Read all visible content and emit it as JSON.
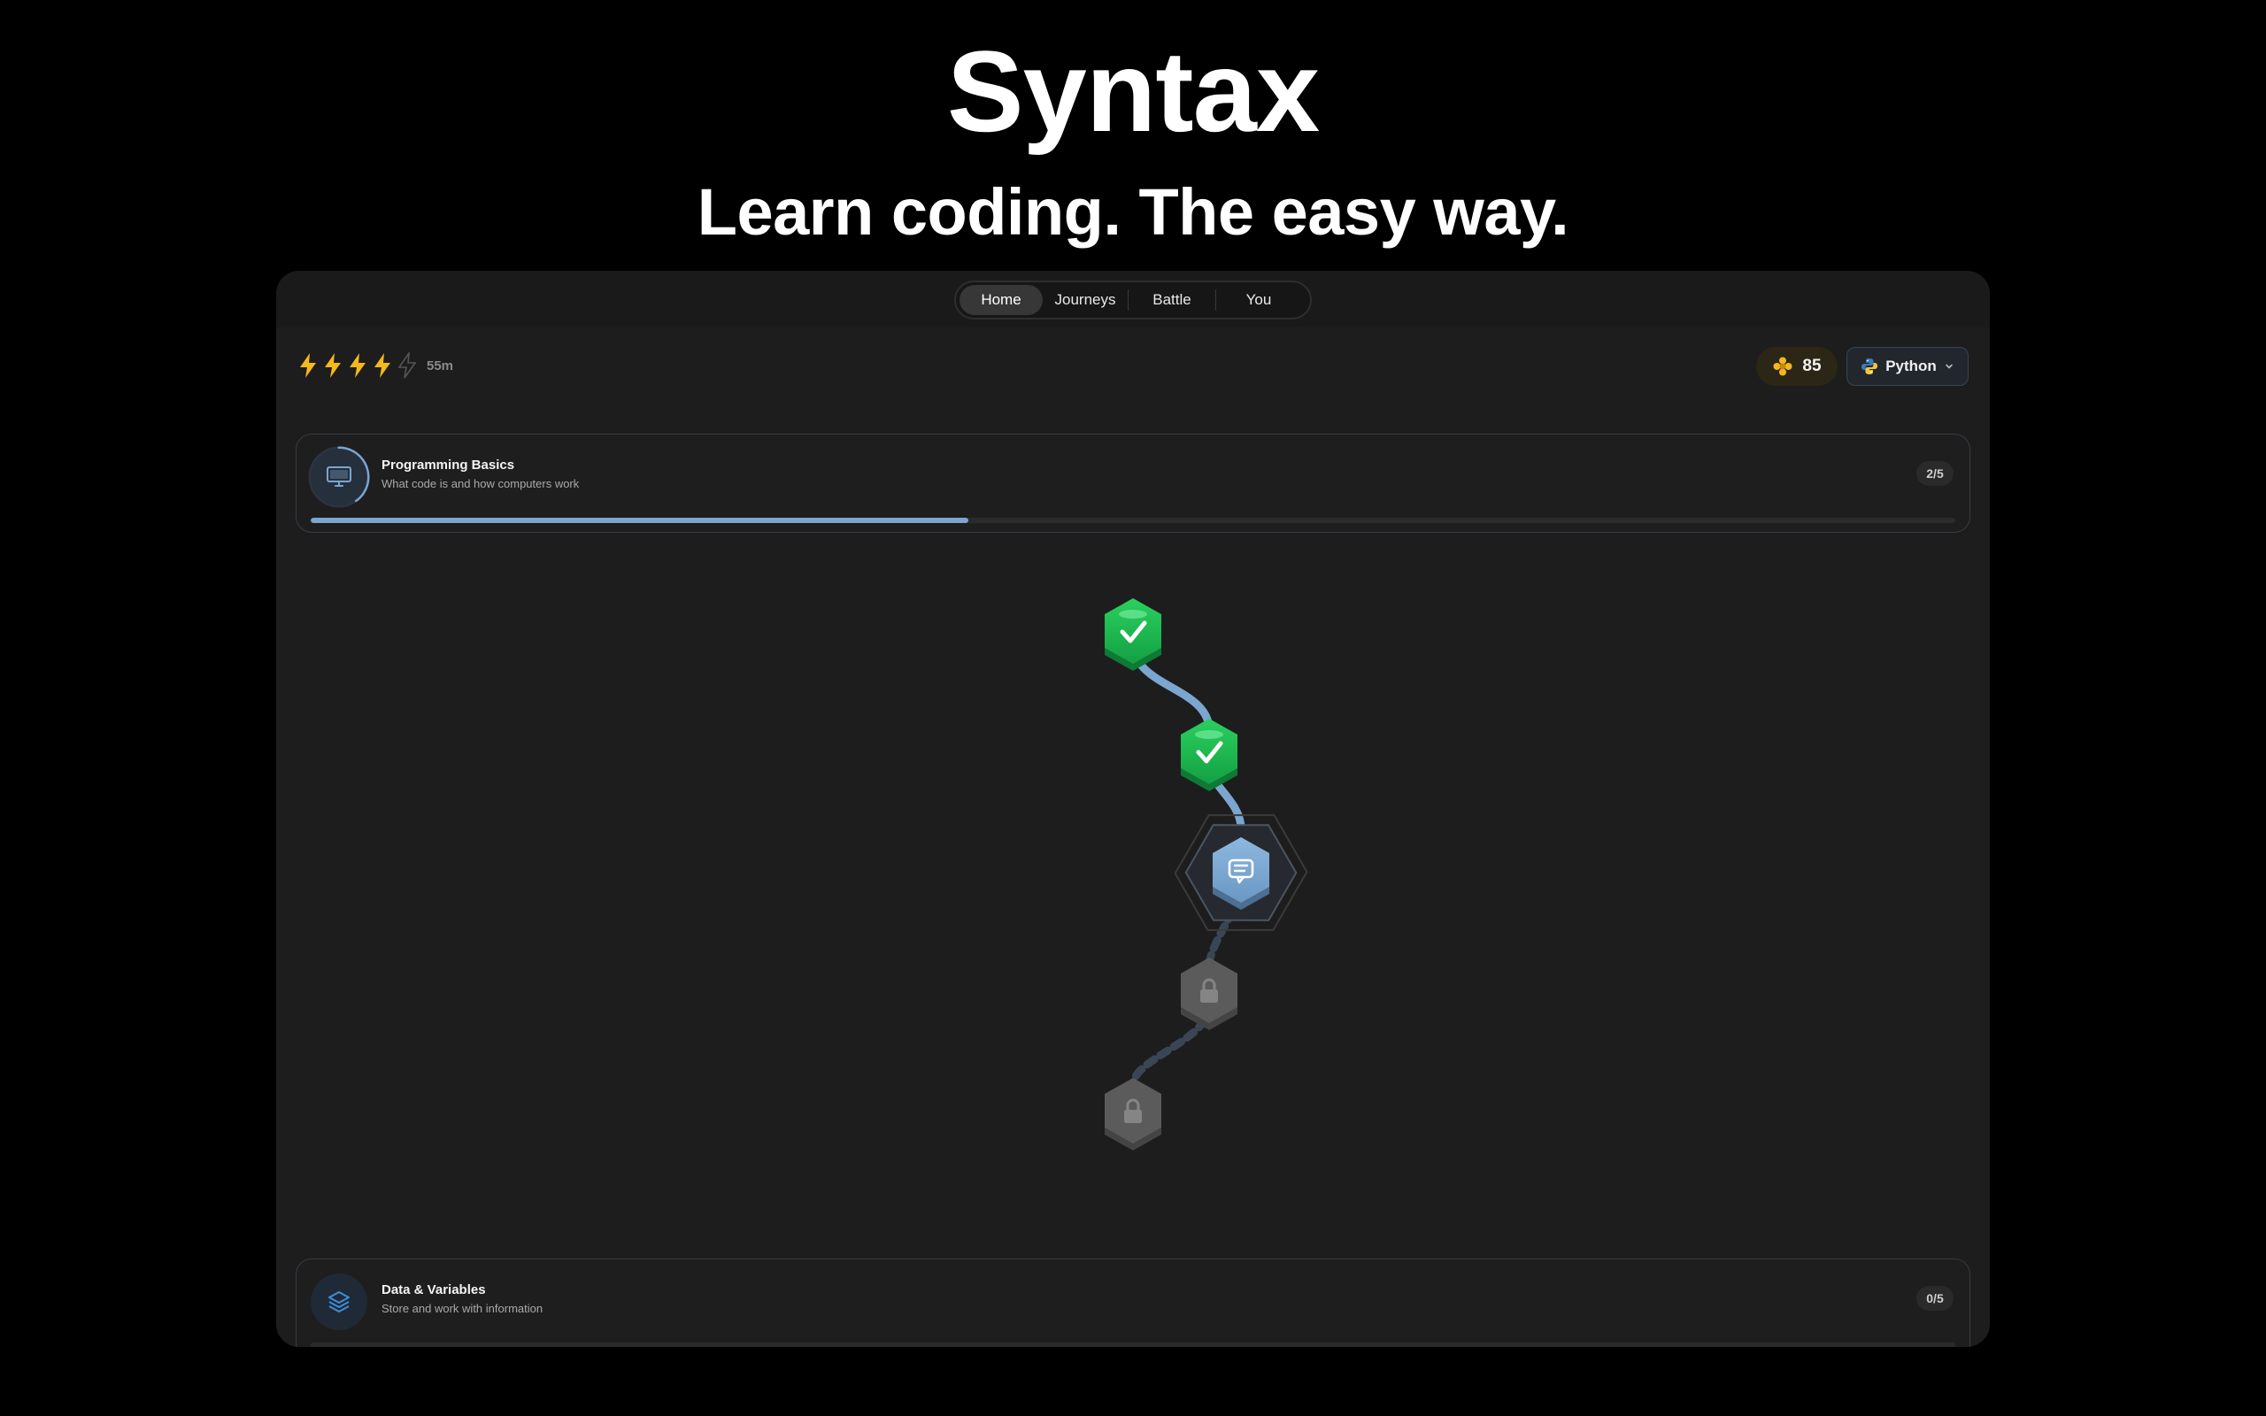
{
  "hero": {
    "title": "Syntax",
    "subtitle": "Learn coding. The easy way."
  },
  "nav": {
    "items": [
      {
        "label": "Home",
        "active": true
      },
      {
        "label": "Journeys",
        "active": false
      },
      {
        "label": "Battle",
        "active": false
      },
      {
        "label": "You",
        "active": false
      }
    ]
  },
  "energy": {
    "filled": 4,
    "total": 5,
    "refill_time": "55m",
    "color": "#f5b81c"
  },
  "coins": {
    "value": "85",
    "icon": "flower-coin-icon",
    "color": "#f5b81c"
  },
  "language": {
    "label": "Python",
    "icon": "python-icon"
  },
  "units": [
    {
      "title": "Programming Basics",
      "description": "What code is and how computers work",
      "count": "2/5",
      "progress": 0.4,
      "icon": "monitor-icon"
    },
    {
      "title": "Data & Variables",
      "description": "Store and work with information",
      "count": "0/5",
      "progress": 0,
      "icon": "layers-icon"
    }
  ],
  "lessons": [
    {
      "state": "completed",
      "icon": "check-icon"
    },
    {
      "state": "completed",
      "icon": "check-icon"
    },
    {
      "state": "current",
      "icon": "chat-icon"
    },
    {
      "state": "locked",
      "icon": "lock-icon"
    },
    {
      "state": "locked",
      "icon": "lock-icon"
    }
  ],
  "colors": {
    "accent": "#7aa6d0",
    "completed": "#1fb34f",
    "locked": "#5b5b5b",
    "background": "#1d1d1d"
  }
}
